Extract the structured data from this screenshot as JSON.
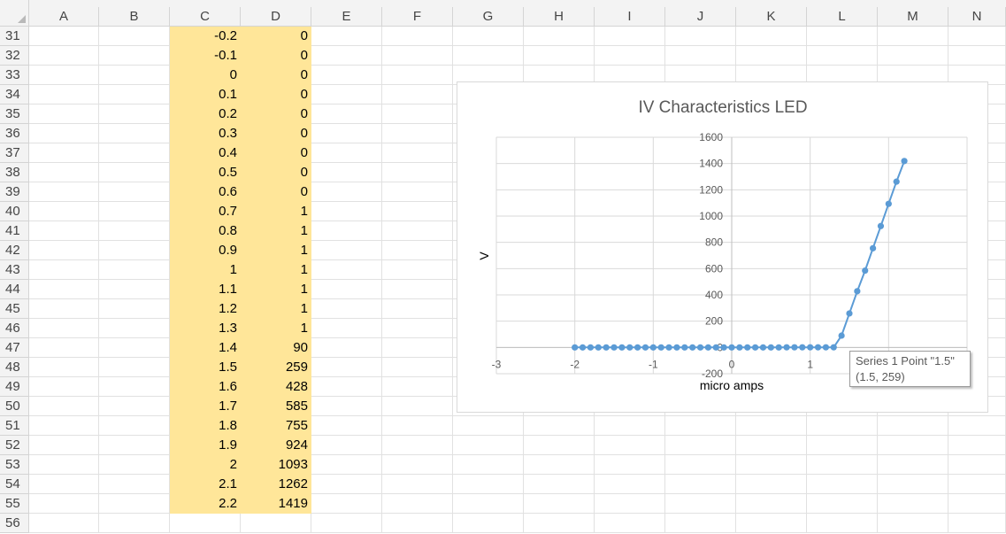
{
  "spreadsheet": {
    "columns": [
      "A",
      "B",
      "C",
      "D",
      "E",
      "F",
      "G",
      "H",
      "I",
      "J",
      "K",
      "L",
      "M",
      "N"
    ],
    "rows": [
      {
        "row": "31",
        "c": "-0.2",
        "d": "0"
      },
      {
        "row": "32",
        "c": "-0.1",
        "d": "0"
      },
      {
        "row": "33",
        "c": "0",
        "d": "0"
      },
      {
        "row": "34",
        "c": "0.1",
        "d": "0"
      },
      {
        "row": "35",
        "c": "0.2",
        "d": "0"
      },
      {
        "row": "36",
        "c": "0.3",
        "d": "0"
      },
      {
        "row": "37",
        "c": "0.4",
        "d": "0"
      },
      {
        "row": "38",
        "c": "0.5",
        "d": "0"
      },
      {
        "row": "39",
        "c": "0.6",
        "d": "0"
      },
      {
        "row": "40",
        "c": "0.7",
        "d": "1"
      },
      {
        "row": "41",
        "c": "0.8",
        "d": "1"
      },
      {
        "row": "42",
        "c": "0.9",
        "d": "1"
      },
      {
        "row": "43",
        "c": "1",
        "d": "1"
      },
      {
        "row": "44",
        "c": "1.1",
        "d": "1"
      },
      {
        "row": "45",
        "c": "1.2",
        "d": "1"
      },
      {
        "row": "46",
        "c": "1.3",
        "d": "1"
      },
      {
        "row": "47",
        "c": "1.4",
        "d": "90"
      },
      {
        "row": "48",
        "c": "1.5",
        "d": "259"
      },
      {
        "row": "49",
        "c": "1.6",
        "d": "428"
      },
      {
        "row": "50",
        "c": "1.7",
        "d": "585"
      },
      {
        "row": "51",
        "c": "1.8",
        "d": "755"
      },
      {
        "row": "52",
        "c": "1.9",
        "d": "924"
      },
      {
        "row": "53",
        "c": "2",
        "d": "1093"
      },
      {
        "row": "54",
        "c": "2.1",
        "d": "1262"
      },
      {
        "row": "55",
        "c": "2.2",
        "d": "1419"
      },
      {
        "row": "56",
        "c": "",
        "d": ""
      }
    ],
    "highlight_color": "#ffe699"
  },
  "chart_data": {
    "type": "scatter",
    "title": "IV Characteristics LED",
    "xlabel": "micro amps",
    "ylabel": "V",
    "xlim": [
      -3,
      3
    ],
    "ylim": [
      -200,
      1600
    ],
    "x_ticks": [
      "-3",
      "-2",
      "-1",
      "0",
      "1"
    ],
    "y_ticks": [
      "-200",
      "0",
      "200",
      "400",
      "600",
      "800",
      "1000",
      "1200",
      "1400",
      "1600"
    ],
    "grid": true,
    "series": [
      {
        "name": "Series 1",
        "color": "#5b9bd5",
        "x": [
          -2,
          -1.9,
          -1.8,
          -1.7,
          -1.6,
          -1.5,
          -1.4,
          -1.3,
          -1.2,
          -1.1,
          -1,
          -0.9,
          -0.8,
          -0.7,
          -0.6,
          -0.5,
          -0.4,
          -0.3,
          -0.2,
          -0.1,
          0,
          0.1,
          0.2,
          0.3,
          0.4,
          0.5,
          0.6,
          0.7,
          0.8,
          0.9,
          1,
          1.1,
          1.2,
          1.3,
          1.4,
          1.5,
          1.6,
          1.7,
          1.8,
          1.9,
          2,
          2.1,
          2.2
        ],
        "y": [
          0,
          0,
          0,
          0,
          0,
          0,
          0,
          0,
          0,
          0,
          0,
          0,
          0,
          0,
          0,
          0,
          0,
          0,
          0,
          0,
          0,
          0,
          0,
          0,
          0,
          0,
          0,
          1,
          1,
          1,
          1,
          1,
          1,
          1,
          90,
          259,
          428,
          585,
          755,
          924,
          1093,
          1262,
          1419
        ]
      }
    ],
    "tooltip": {
      "line1": "Series 1 Point \"1.5\"",
      "line2": "(1.5, 259)"
    }
  }
}
